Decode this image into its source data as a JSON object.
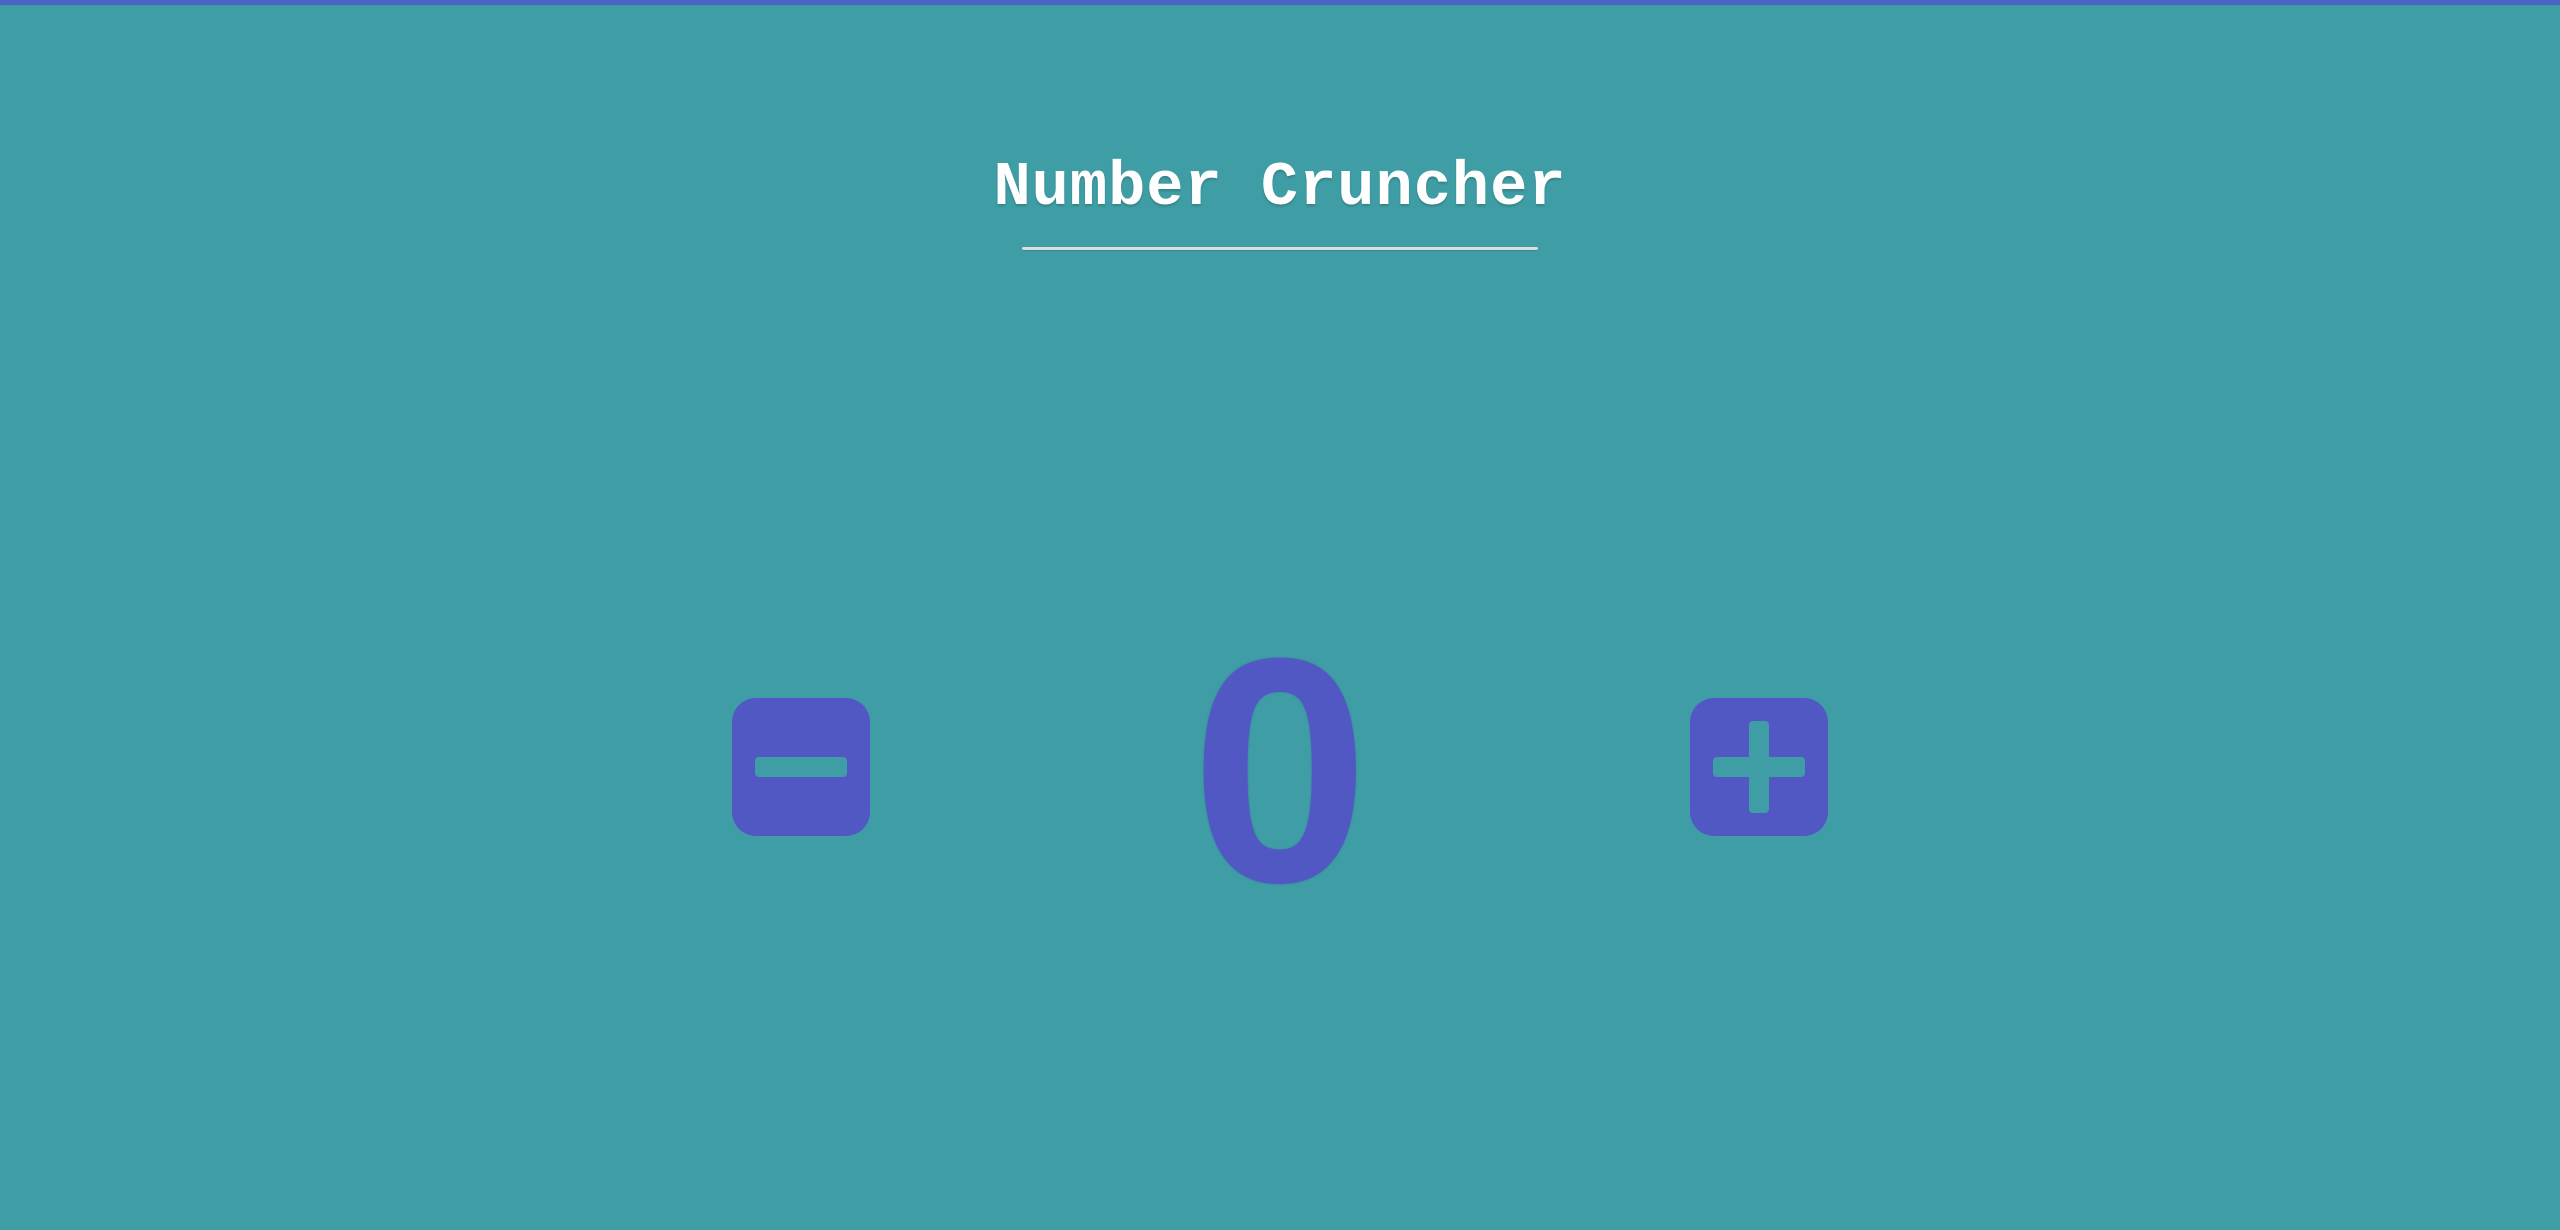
{
  "app": {
    "title": "Number Cruncher"
  },
  "counter": {
    "value": "0"
  },
  "controls": {
    "decrement_icon": "minus-square-icon",
    "increment_icon": "plus-square-icon"
  },
  "colors": {
    "background": "#3f9ea5",
    "accent": "#5158c4",
    "title_text": "#ffffff",
    "top_border": "#4a63c7"
  }
}
